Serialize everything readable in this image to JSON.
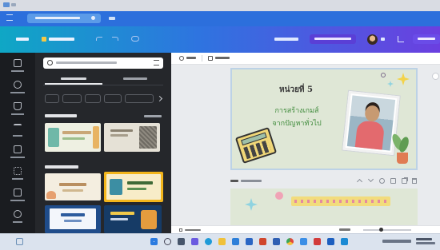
{
  "slide": {
    "title": "หน่วยที่ 5",
    "subtitle_line1": "การสร้างเกมส์",
    "subtitle_line2": "จากปัญหาทั่วไป"
  },
  "colors": {
    "rail": "#1a1c20",
    "panel": "#25272b",
    "header_gradient_start": "#0fa7c5",
    "header_gradient_end": "#6b3fe0",
    "slide_bg": "#dfe7d6",
    "slide_title": "#3a3a3a",
    "slide_subtitle": "#3e8a3a",
    "selection_yellow": "#f2b51b"
  },
  "icons": [
    "browser-tab-icon",
    "menu-icon",
    "undo-icon",
    "redo-icon",
    "search-icon",
    "filter-icon",
    "calculator-illustration",
    "sparkle-icon",
    "windows-start-icon"
  ]
}
